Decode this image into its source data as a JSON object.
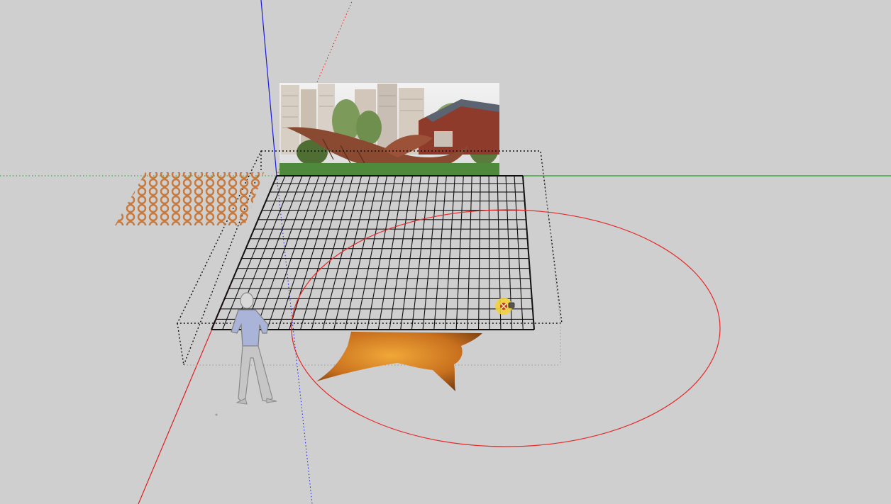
{
  "viewport": {
    "background": "#cfcfcf"
  },
  "axes": {
    "red": "#e02020",
    "green": "#1ea01e",
    "blue": "#1a1ae0"
  },
  "objects": {
    "photo_billboard": {
      "icon": "image-photo"
    },
    "grid_surface": {
      "stroke": "#111111",
      "rows": 16,
      "cols": 29
    },
    "lattice_texture": {
      "color": "#c8783a"
    },
    "leaf_texture": {
      "color": "#d98a2a"
    },
    "circle": {
      "color": "#e62a2a"
    },
    "scale_figure": {
      "icon": "person-figure"
    },
    "cursor": {
      "icon": "orbit-cursor-icon"
    }
  }
}
